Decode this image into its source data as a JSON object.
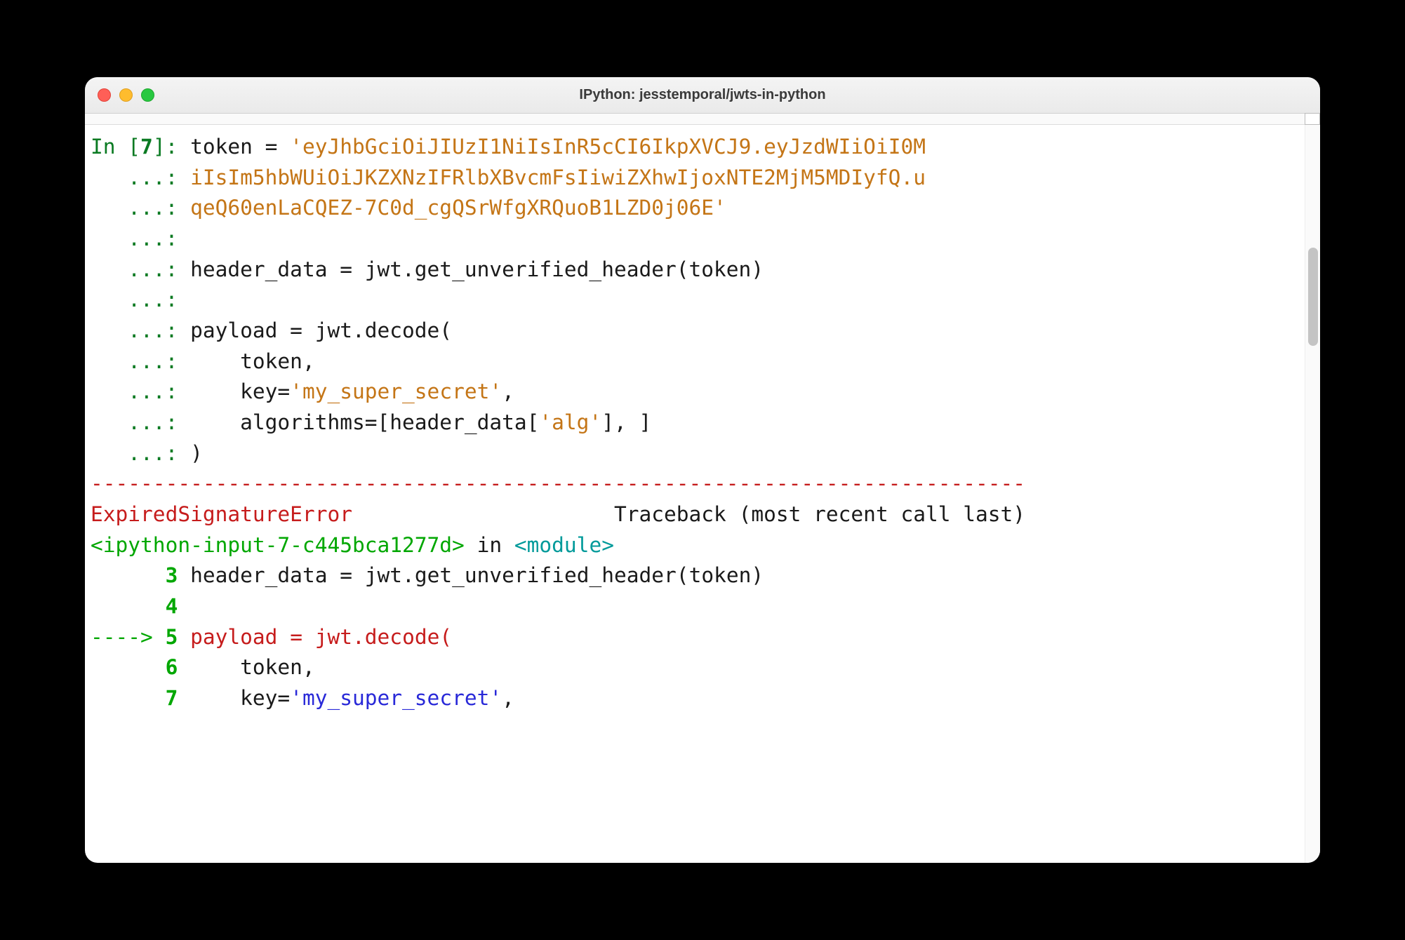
{
  "window": {
    "title": "IPython: jesstemporal/jwts-in-python"
  },
  "colors": {
    "prompt_green": "#0a7a22",
    "string_orange": "#c47516",
    "error_red": "#c61c1c",
    "tb_green": "#00a700",
    "tb_cyan": "#009a9a",
    "tb_blue": "#2929d8"
  },
  "prompt": {
    "in_label": "In [",
    "in_number": "7",
    "in_close": "]: ",
    "continuation": "   ...: "
  },
  "code": {
    "l1_pre": "token = ",
    "l1_str": "'eyJhbGciOiJIUzI1NiIsInR5cCI6IkpXVCJ9.eyJzdWIiOiI0M",
    "l2_str": "iIsIm5hbWUiOiJKZXNzIFRlbXBvcmFsIiwiZXhwIjoxNTE2MjM5MDIyfQ.u",
    "l3_str": "qeQ60enLaCQEZ-7C0d_cgQSrWfgXRQuoB1LZD0j06E'",
    "l4": "",
    "l5": "header_data = jwt.get_unverified_header(token)",
    "l6": "",
    "l7": "payload = jwt.decode(",
    "l8": "    token,",
    "l9_pre": "    key=",
    "l9_str": "'my_super_secret'",
    "l9_post": ",",
    "l10_pre": "    algorithms=[header_data[",
    "l10_str": "'alg'",
    "l10_post": "], ]",
    "l11": ")"
  },
  "traceback": {
    "separator": "---------------------------------------------------------------------------",
    "error_name": "ExpiredSignatureError",
    "error_spacing": "                     ",
    "tb_label": "Traceback (most recent call last)",
    "ipython_ref": "<ipython-input-7-c445bca1277d>",
    "in_word": " in ",
    "module": "<module>",
    "line3_num": "      3 ",
    "line3_code": "header_data ",
    "line3_eq": "=",
    "line3_rest": " jwt",
    "line3_dot": ".",
    "line3_call": "get_unverified_header",
    "line3_paren": "(",
    "line3_arg": "token",
    "line3_close": ")",
    "line4_num": "      4 ",
    "arrow": "----> ",
    "line5_num": "5 ",
    "line5_code": "payload ",
    "line5_eq": "=",
    "line5_rest": " jwt",
    "line5_dot": ".",
    "line5_call": "decode",
    "line5_paren": "(",
    "line6_num": "      6 ",
    "line6_code": "    token",
    "line6_comma": ",",
    "line7_num": "      7 ",
    "line7_code": "    key",
    "line7_eq": "=",
    "line7_str": "'my_super_secret'",
    "line7_comma": ","
  }
}
